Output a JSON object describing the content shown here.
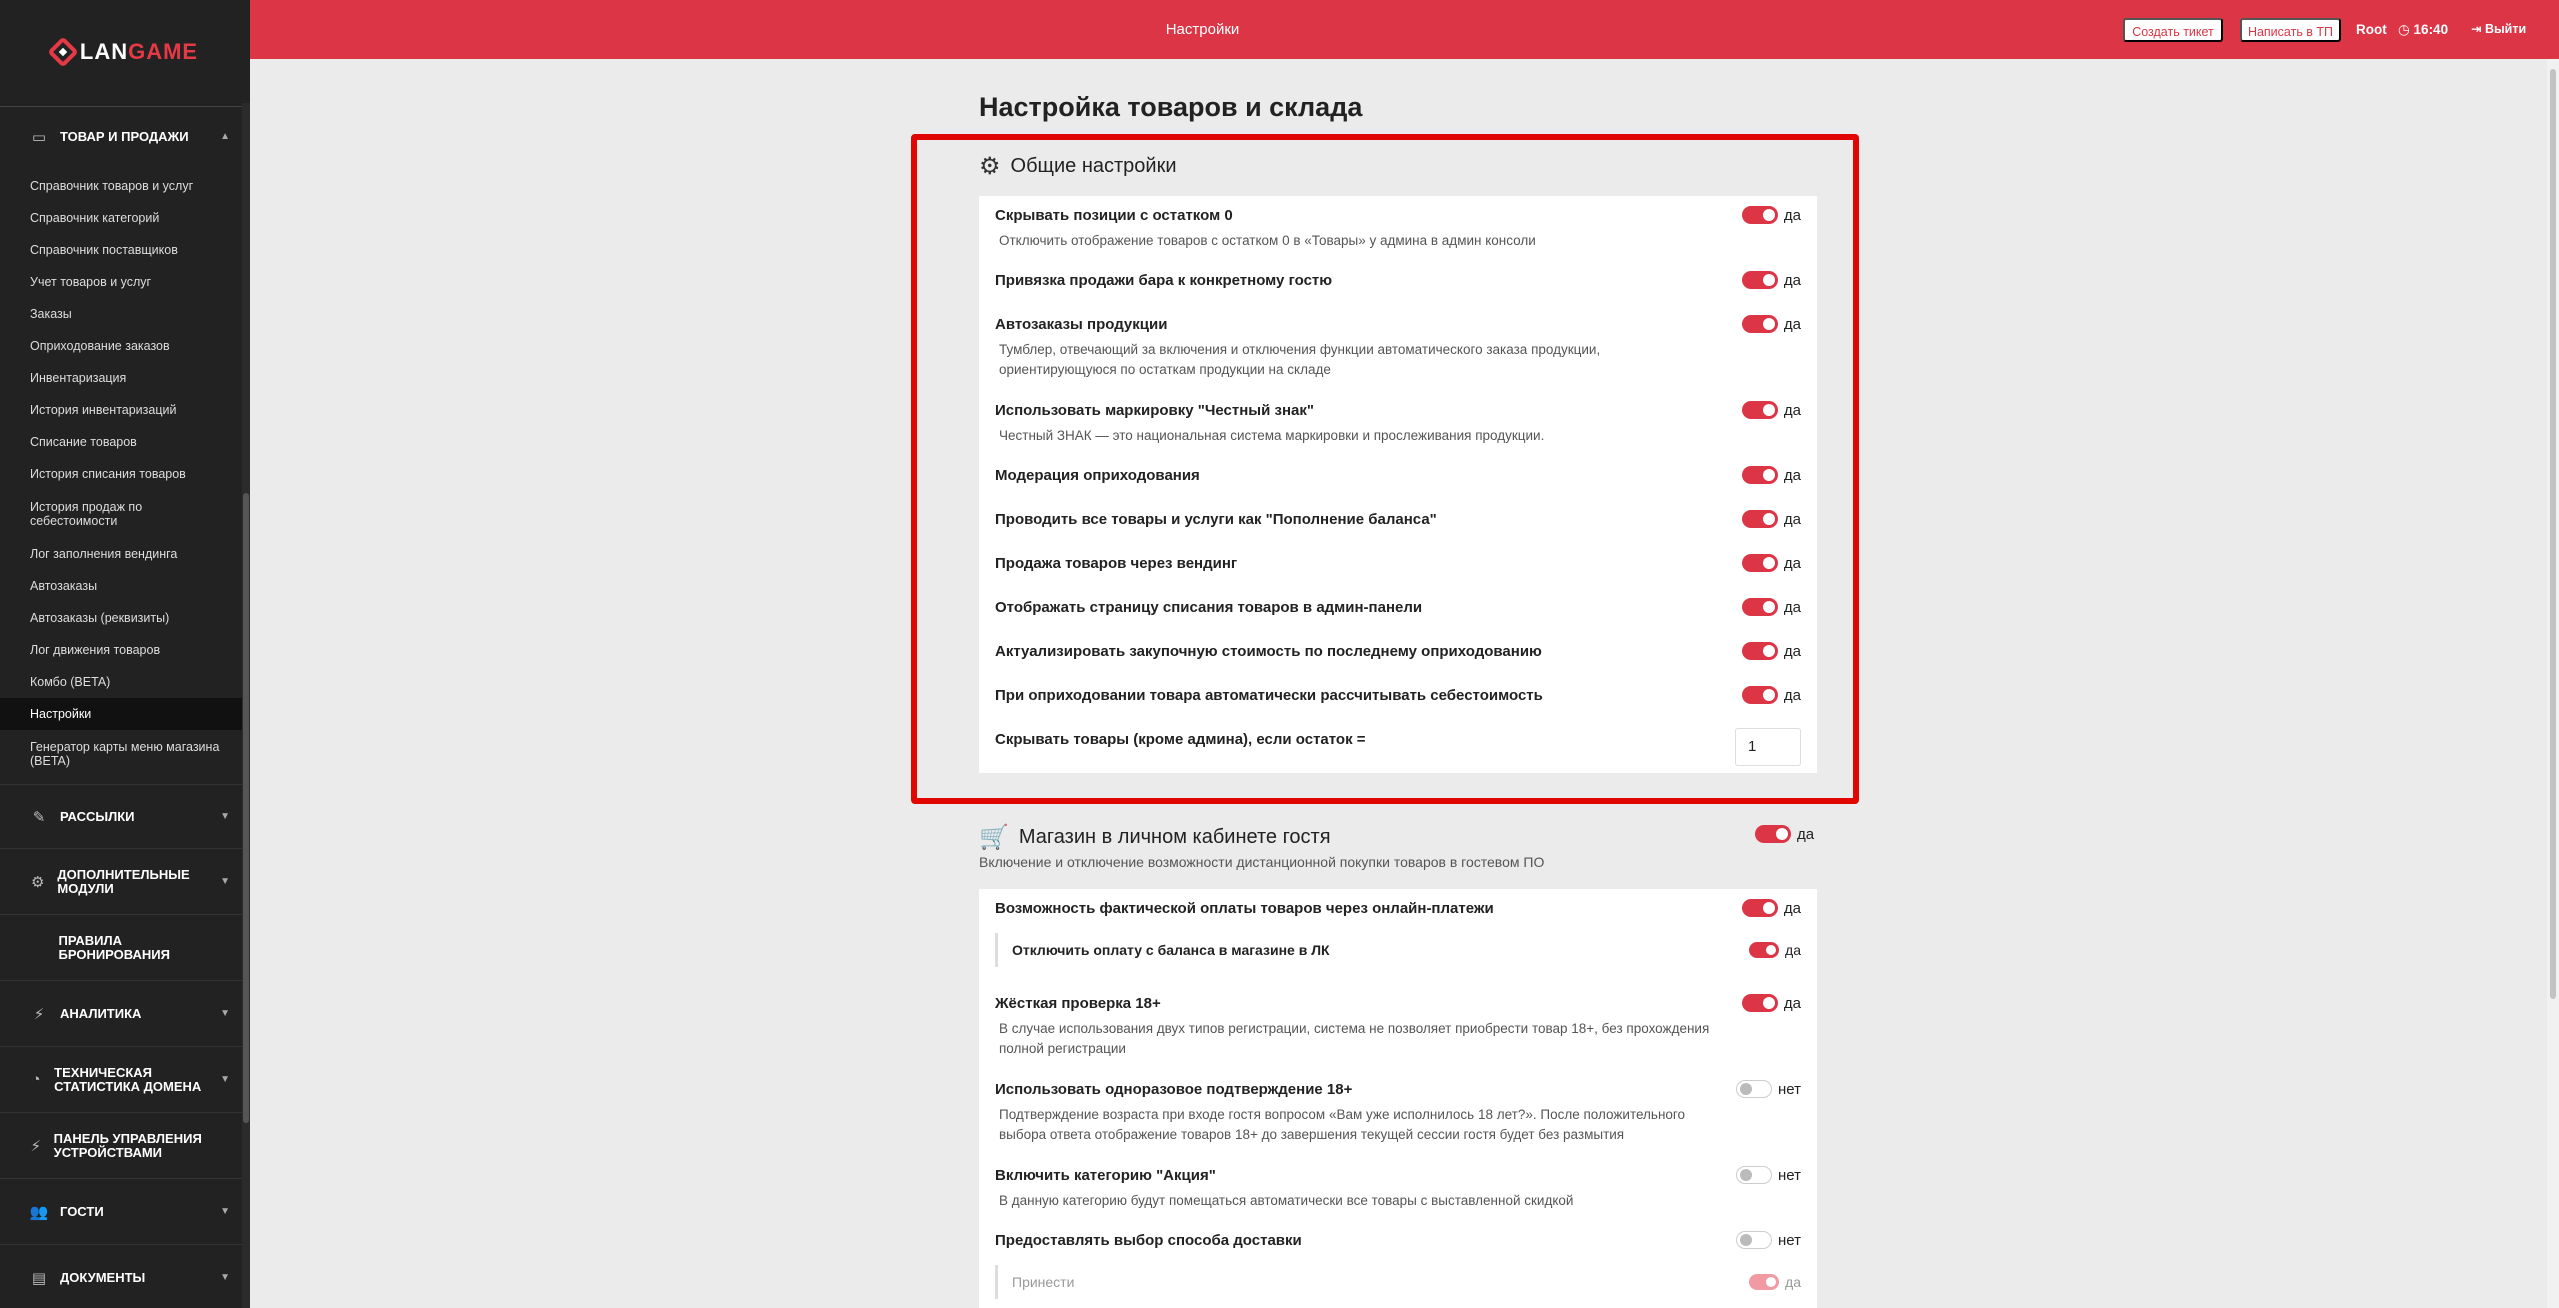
{
  "app": {
    "logo_prefix": "LAN",
    "logo_suffix": "GAME"
  },
  "topbar": {
    "title": "Настройки",
    "create_ticket": "Создать тикет",
    "write_support": "Написать в ТП",
    "user": "Root",
    "time": "16:40",
    "logout": "Выйти"
  },
  "sidebar": {
    "section_goods": "ТОВАР И ПРОДАЖИ",
    "items": [
      "Справочник товаров и услуг",
      "Справочник категорий",
      "Справочник поставщиков",
      "Учет товаров и услуг",
      "Заказы",
      "Оприходование заказов",
      "Инвентаризация",
      "История инвентаризаций",
      "Списание товаров",
      "История списания товаров",
      "История продаж по себестоимости",
      "Лог заполнения вендинга",
      "Автозаказы",
      "Автозаказы (реквизиты)",
      "Лог движения товаров",
      "Комбо (BETA)",
      "Настройки",
      "Генератор карты меню магазина (BETA)"
    ],
    "sections": [
      "РАССЫЛКИ",
      "ДОПОЛНИТЕЛЬНЫЕ МОДУЛИ",
      "ПРАВИЛА БРОНИРОВАНИЯ",
      "АНАЛИТИКА",
      "ТЕХНИЧЕСКАЯ СТАТИСТИКА ДОМЕНА",
      "ПАНЕЛЬ УПРАВЛЕНИЯ УСТРОЙСТВАМИ",
      "ГОСТИ",
      "ДОКУМЕНТЫ"
    ]
  },
  "page": {
    "title": "Настройка товаров и склада",
    "yes": "да",
    "no": "нет",
    "general": {
      "title": "Общие настройки",
      "rows": [
        {
          "title": "Скрывать позиции с остатком 0",
          "desc": "Отключить отображение товаров с остатком 0 в «Товары» у админа в админ консоли"
        },
        {
          "title": "Привязка продажи бара к конкретному гостю",
          "desc": ""
        },
        {
          "title": "Автозаказы продукции",
          "desc": "Тумблер, отвечающий за включения и отключения функции автоматического заказа продукции,",
          "desc2": "ориентирующуюся по остаткам продукции на складе"
        },
        {
          "title": "Использовать маркировку \"Честный знак\"",
          "desc": "Честный ЗНАК — это национальная система маркировки и прослеживания продукции."
        },
        {
          "title": "Модерация оприходования",
          "desc": ""
        },
        {
          "title": "Проводить все товары и услуги как \"Пополнение баланса\"",
          "desc": ""
        },
        {
          "title": "Продажа товаров через вендинг",
          "desc": ""
        },
        {
          "title": "Отображать страницу списания товаров в админ-панели",
          "desc": ""
        },
        {
          "title": "Актуализировать закупочную стоимость по последнему оприходованию",
          "desc": ""
        },
        {
          "title": "При оприходовании товара автоматически рассчитывать себестоимость",
          "desc": ""
        }
      ],
      "hide_label": "Скрывать товары (кроме админа), если остаток =",
      "hide_value": "1"
    },
    "shop": {
      "title": "Магазин в личном кабинете гостя",
      "subtitle": "Включение и отключение возможности дистанционной покупки товаров в гостевом ПО",
      "rows": [
        {
          "title": "Возможность фактической оплаты товаров через онлайн-платежи",
          "desc": ""
        },
        {
          "title": "Отключить оплату с баланса в магазине в ЛК",
          "desc": ""
        },
        {
          "title": "Жёсткая проверка 18+",
          "desc": "В случае использования двух типов регистрации, система не позволяет приобрести товар 18+, без прохождения",
          "desc2": "полной регистрации"
        },
        {
          "title": "Использовать одноразовое подтверждение 18+",
          "desc": "Подтверждение возраста при входе гостя вопросом «Вам уже исполнилось 18 лет?». После положительного",
          "desc2": "выбора ответа отображение товаров 18+ до завершения текущей сессии гостя будет без размытия"
        },
        {
          "title": "Включить категорию \"Акция\"",
          "desc": "В данную категорию будут помещаться автоматически все товары с выставленной скидкой"
        },
        {
          "title": "Предоставлять выбор способа доставки",
          "desc": ""
        },
        {
          "title": "Принести",
          "desc": ""
        }
      ]
    }
  }
}
